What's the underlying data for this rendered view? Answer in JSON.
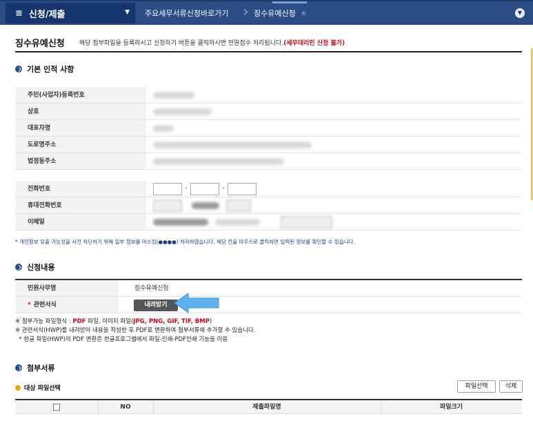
{
  "nav": {
    "menu_label": "신청/제출",
    "crumbs": [
      "주요세무서류신청바로가기",
      "징수유예신청"
    ]
  },
  "page": {
    "title": "징수유예신청",
    "description": "해당 첨부파일을 등록하시고 신청하기 버튼을 클릭하시면 민원접수 처리됩니다.",
    "warning": "(세무대리인 신청 불가)"
  },
  "basic_info": {
    "heading": "기본 인적 사항",
    "rows": [
      {
        "label": "주민(사업자)등록번호"
      },
      {
        "label": "상호"
      },
      {
        "label": "대표자명"
      },
      {
        "label": "도로명주소"
      },
      {
        "label": "법정동주소"
      }
    ],
    "contact_rows": [
      {
        "label": "전화번호"
      },
      {
        "label": "휴대전화번호"
      },
      {
        "label": "이메일"
      }
    ],
    "phone_separator": "-",
    "notice": "* 개인정보 유출 가능성을 사전 차단하기 위해 일부 정보를 마스킹(●●●●) 처리하였습니다. 해당 칸을 마우스로 클릭하면 입력된 정보를 확인할 수 있습니다."
  },
  "application": {
    "heading": "신청내용",
    "rows": [
      {
        "label": "민원사무명",
        "value": "징수유예신청"
      },
      {
        "label": "관련서식",
        "required_mark": "*",
        "button": "내려받기"
      }
    ],
    "notes": [
      {
        "prefix": "※ 첨부가능 파일형식 : ",
        "pdf": "PDF",
        "mid": " 파일, 이미지 파일(",
        "images": "JPG, PNG, GIF, TIF, BMP",
        "suffix": ")"
      },
      {
        "text": "※ 관련서식(HWP)를 내려받아 내용을 작성한 후 PDF로 변환하여 첨부서류에 추가할 수 있습니다."
      },
      {
        "text": "  * 한글 파일(HWP)의 PDF 변환은 한글프로그램에서 파일-인쇄-PDF인쇄 기능을 이용"
      }
    ]
  },
  "attachments": {
    "heading": "첨부서류",
    "subheading": "대상 파일선택",
    "select_button": "파일선택",
    "delete_button": "삭제",
    "columns": [
      "NO",
      "제출파일명",
      "파일크기"
    ]
  },
  "colors": {
    "nav_bg": "#2b4d85",
    "menu_bg": "#163570",
    "warning": "#d0021b",
    "arrow": "#5bb2ef"
  }
}
